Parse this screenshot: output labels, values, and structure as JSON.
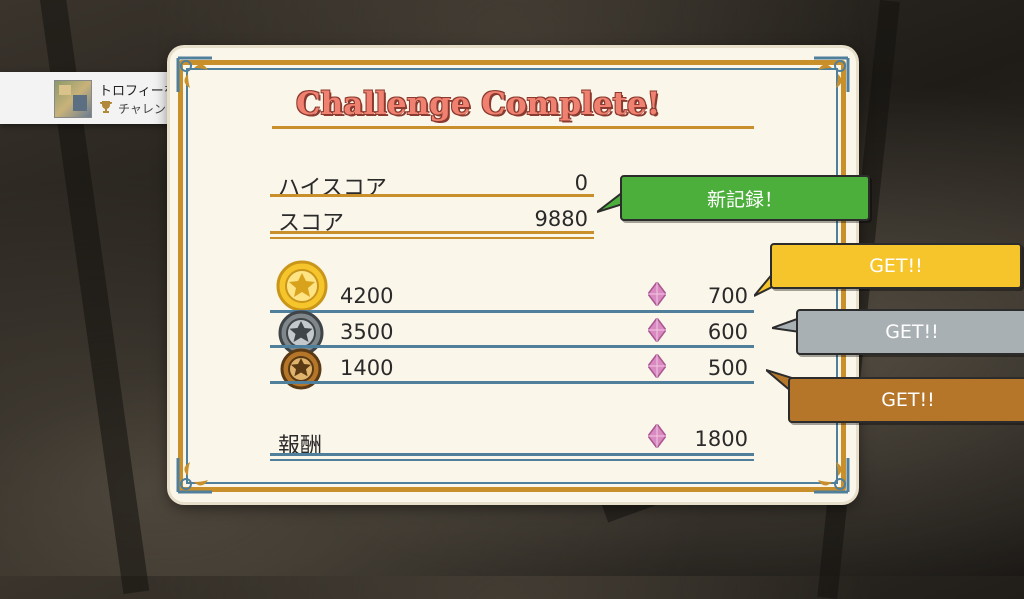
{
  "trophy_toast": {
    "title": "トロフィーを獲得しました！",
    "trophy_name": "チャレンジの女王",
    "colors": {
      "trophy": "#b08a3a"
    }
  },
  "result": {
    "headline": "Challenge Complete!",
    "high_score_label": "ハイスコア",
    "high_score_value": "0",
    "score_label": "スコア",
    "score_value": "9880",
    "new_record_text": "新記録！",
    "medal_rows": [
      {
        "medal": "gold",
        "threshold": "4200",
        "reward": "700",
        "get_text": "GET!!",
        "color": "#f5c52b"
      },
      {
        "medal": "silver",
        "threshold": "3500",
        "reward": "600",
        "get_text": "GET!!",
        "color": "#a9b0b4"
      },
      {
        "medal": "bronze",
        "threshold": "1400",
        "reward": "500",
        "get_text": "GET!!",
        "color": "#b5762a"
      }
    ],
    "total_label": "報酬",
    "total_value": "1800",
    "colors": {
      "new_record": "#4caf3c",
      "headline": "#f08070",
      "frame_gold": "#c98f2a",
      "frame_blue": "#4f7f9a",
      "gem": "#d98ac0"
    }
  }
}
